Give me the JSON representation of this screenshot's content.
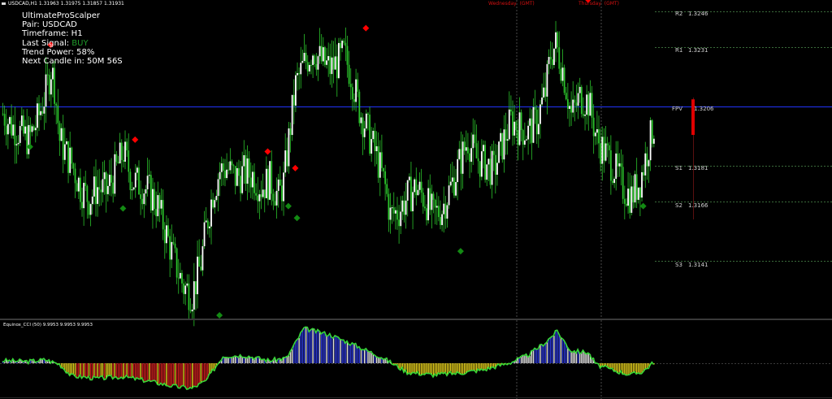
{
  "symbol_bar": {
    "text": "USDCAD,H1  1.31963 1.31975 1.31857 1.31931"
  },
  "info_panel": {
    "title": "UltimateProScalper",
    "pair": "Pair: USDCAD",
    "timeframe": "Timeframe: H1",
    "last_signal_label": "Last Signal: ",
    "last_signal_value": "BUY",
    "trend_power": "Trend Power: 58%",
    "next_candle": "Next Candle in: 50M 56S"
  },
  "day_labels": [
    {
      "day": "Wednesday",
      "tz": "(GMT)"
    },
    {
      "day": "Thursday",
      "tz": "(GMT)"
    }
  ],
  "pivots": [
    {
      "name": "R2",
      "value": "1.3246"
    },
    {
      "name": "R1",
      "value": "1.3231"
    },
    {
      "name": "FPV",
      "value": "1.3206"
    },
    {
      "name": "S1",
      "value": "1.3181"
    },
    {
      "name": "S2",
      "value": "1.3166"
    },
    {
      "name": "S3",
      "value": "1.3141"
    }
  ],
  "indicator": {
    "title": "Equinox_CCI (50) 9.9953 9.9953 9.9953"
  },
  "colors": {
    "background": "#000000",
    "bull_candle": "#ffffff",
    "bear_candle": "#2bc32b",
    "wick": "#2bc32b",
    "sell_signal": "#ff0000",
    "buy_signal": "#138a13",
    "fpv_line": "#1c2cd8",
    "cci_line": "#36d536",
    "cci_pos_high": "#2d39d8",
    "cci_pos_low": "#e6e6e6",
    "cci_neg_high": "#e8d21c",
    "cci_neg_low": "#d42020",
    "separator": "#5a5a5a"
  },
  "chart_data": {
    "type": "candlestick",
    "symbol": "USDCAD",
    "timeframe": "H1",
    "price_ref": [
      {
        "name": "R2",
        "value": 1.3246
      },
      {
        "name": "R1",
        "value": 1.3231
      },
      {
        "name": "FPV",
        "value": 1.3206
      },
      {
        "name": "S1",
        "value": 1.3181
      },
      {
        "name": "S2",
        "value": 1.3166
      },
      {
        "name": "S3",
        "value": 1.3141
      }
    ],
    "close_path": [
      [
        0,
        1.3203
      ],
      [
        5,
        1.3198
      ],
      [
        10,
        1.3195
      ],
      [
        15,
        1.3192
      ],
      [
        20,
        1.32
      ],
      [
        25,
        1.3212
      ],
      [
        28,
        1.3222
      ],
      [
        30,
        1.3215
      ],
      [
        33,
        1.3192
      ],
      [
        37,
        1.3186
      ],
      [
        40,
        1.3182
      ],
      [
        45,
        1.3172
      ],
      [
        50,
        1.3167
      ],
      [
        55,
        1.3172
      ],
      [
        60,
        1.317
      ],
      [
        65,
        1.3178
      ],
      [
        70,
        1.3187
      ],
      [
        75,
        1.3175
      ],
      [
        80,
        1.3173
      ],
      [
        85,
        1.317
      ],
      [
        90,
        1.3164
      ],
      [
        95,
        1.3152
      ],
      [
        100,
        1.314
      ],
      [
        105,
        1.313
      ],
      [
        110,
        1.3127
      ],
      [
        115,
        1.314
      ],
      [
        118,
        1.3155
      ],
      [
        122,
        1.317
      ],
      [
        126,
        1.3179
      ],
      [
        130,
        1.318
      ],
      [
        135,
        1.3176
      ],
      [
        140,
        1.3178
      ],
      [
        145,
        1.3177
      ],
      [
        150,
        1.3172
      ],
      [
        155,
        1.3175
      ],
      [
        160,
        1.3168
      ],
      [
        163,
        1.3174
      ],
      [
        167,
        1.3198
      ],
      [
        170,
        1.3215
      ],
      [
        175,
        1.3224
      ],
      [
        180,
        1.323
      ],
      [
        185,
        1.3225
      ],
      [
        190,
        1.3222
      ],
      [
        195,
        1.3225
      ],
      [
        198,
        1.3228
      ],
      [
        202,
        1.322
      ],
      [
        207,
        1.3205
      ],
      [
        212,
        1.3195
      ],
      [
        217,
        1.3185
      ],
      [
        222,
        1.3172
      ],
      [
        225,
        1.316
      ],
      [
        230,
        1.3162
      ],
      [
        235,
        1.3168
      ],
      [
        240,
        1.3172
      ],
      [
        245,
        1.3167
      ],
      [
        250,
        1.316
      ],
      [
        255,
        1.3163
      ],
      [
        260,
        1.3172
      ],
      [
        265,
        1.3182
      ],
      [
        270,
        1.3192
      ],
      [
        275,
        1.3184
      ],
      [
        280,
        1.3182
      ],
      [
        285,
        1.3179
      ],
      [
        290,
        1.319
      ],
      [
        295,
        1.32
      ],
      [
        300,
        1.3197
      ],
      [
        305,
        1.3195
      ],
      [
        310,
        1.32
      ],
      [
        315,
        1.3212
      ],
      [
        318,
        1.3228
      ],
      [
        321,
        1.3232
      ],
      [
        325,
        1.3222
      ],
      [
        330,
        1.3202
      ],
      [
        335,
        1.321
      ],
      [
        340,
        1.3208
      ],
      [
        345,
        1.3192
      ],
      [
        350,
        1.3186
      ],
      [
        355,
        1.318
      ],
      [
        360,
        1.3172
      ],
      [
        365,
        1.3168
      ],
      [
        370,
        1.3175
      ],
      [
        375,
        1.319
      ],
      [
        378,
        1.3198
      ]
    ],
    "signals": [
      {
        "type": "sell",
        "index": 28,
        "price": 1.3232
      },
      {
        "type": "buy",
        "index": 16,
        "price": 1.3189
      },
      {
        "type": "sell",
        "index": 77,
        "price": 1.3192
      },
      {
        "type": "buy",
        "index": 70,
        "price": 1.3163
      },
      {
        "type": "buy",
        "index": 126,
        "price": 1.3118
      },
      {
        "type": "sell",
        "index": 154,
        "price": 1.3187
      },
      {
        "type": "sell",
        "index": 170,
        "price": 1.318
      },
      {
        "type": "buy",
        "index": 166,
        "price": 1.3164
      },
      {
        "type": "buy",
        "index": 171,
        "price": 1.3159
      },
      {
        "type": "sell",
        "index": 211,
        "price": 1.3239
      },
      {
        "type": "buy",
        "index": 266,
        "price": 1.3145
      },
      {
        "type": "sell",
        "index": 340,
        "price": 1.3251
      },
      {
        "type": "buy",
        "index": 372,
        "price": 1.3164
      }
    ],
    "cci_path": [
      [
        0,
        0.3
      ],
      [
        15,
        0.2
      ],
      [
        25,
        0.4
      ],
      [
        33,
        -0.1
      ],
      [
        40,
        -1.4
      ],
      [
        55,
        -1.7
      ],
      [
        70,
        -1.5
      ],
      [
        85,
        -2.0
      ],
      [
        100,
        -2.6
      ],
      [
        110,
        -2.8
      ],
      [
        118,
        -2.0
      ],
      [
        128,
        0.8
      ],
      [
        140,
        0.9
      ],
      [
        155,
        0.3
      ],
      [
        165,
        0.6
      ],
      [
        175,
        3.9
      ],
      [
        190,
        3.2
      ],
      [
        205,
        2.0
      ],
      [
        220,
        0.7
      ],
      [
        235,
        -1.0
      ],
      [
        250,
        -1.3
      ],
      [
        265,
        -1.1
      ],
      [
        280,
        -0.7
      ],
      [
        295,
        0.1
      ],
      [
        305,
        0.9
      ],
      [
        315,
        2.3
      ],
      [
        322,
        3.6
      ],
      [
        330,
        1.4
      ],
      [
        340,
        1.2
      ],
      [
        345,
        -0.2
      ],
      [
        355,
        -0.8
      ],
      [
        365,
        -1.3
      ],
      [
        372,
        -0.9
      ],
      [
        378,
        0.1
      ]
    ]
  }
}
